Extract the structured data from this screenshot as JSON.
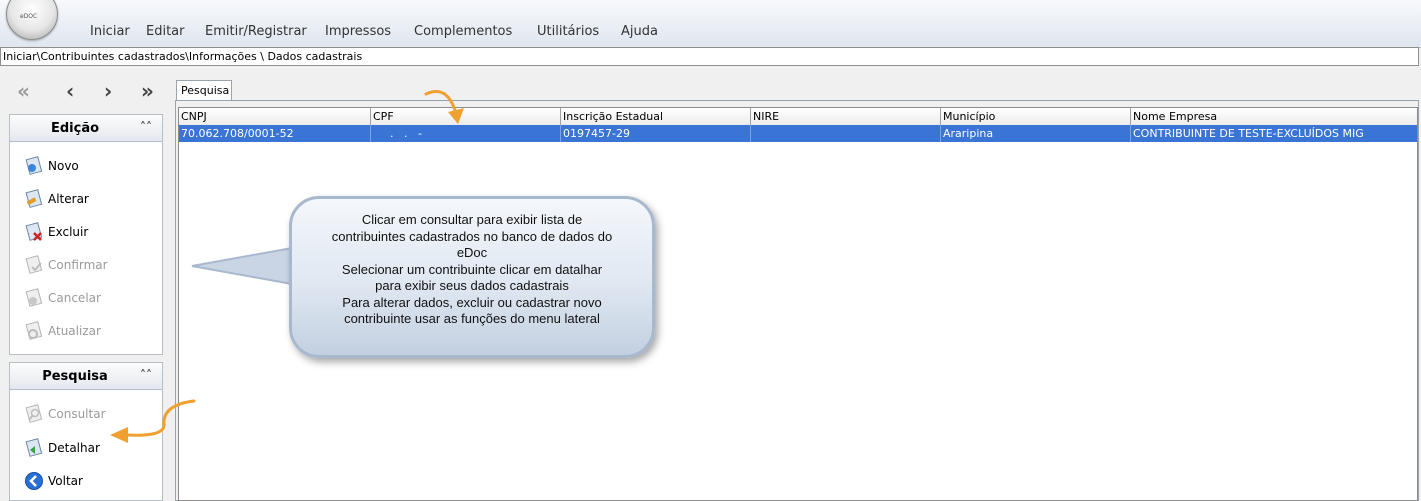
{
  "app": {
    "logo_text": "eDOC"
  },
  "menu": {
    "items": [
      "Iniciar",
      "Editar",
      "Emitir/Registrar",
      "Impressos",
      "Complementos",
      "Utilitários",
      "Ajuda"
    ]
  },
  "breadcrumb": "Iniciar\\Contribuintes cadastrados\\Informações \\ Dados cadastrais",
  "nav": {
    "first": "«",
    "prev": "‹",
    "next": "›",
    "last": "»"
  },
  "sidebar": {
    "edicao": {
      "title": "Edição",
      "collapse_icon": "double-chevron-up-icon",
      "actions": [
        {
          "label": "Novo",
          "enabled": true
        },
        {
          "label": "Alterar",
          "enabled": true
        },
        {
          "label": "Excluir",
          "enabled": true
        },
        {
          "label": "Confirmar",
          "enabled": false
        },
        {
          "label": "Cancelar",
          "enabled": false
        },
        {
          "label": "Atualizar",
          "enabled": false
        }
      ]
    },
    "pesquisa": {
      "title": "Pesquisa",
      "collapse_icon": "double-chevron-up-icon",
      "actions": [
        {
          "label": "Consultar",
          "enabled": false
        },
        {
          "label": "Detalhar",
          "enabled": true
        },
        {
          "label": "Voltar",
          "enabled": true
        }
      ]
    }
  },
  "main": {
    "tab_label": "Pesquisa",
    "table": {
      "columns": [
        "CNPJ",
        "CPF",
        "Inscrição Estadual",
        "NIRE",
        "Município",
        "Nome Empresa"
      ],
      "rows": [
        [
          "70.062.708/0001-52",
          "  .   .   -",
          "0197457-29",
          "",
          "Araripina",
          "CONTRIBUINTE DE TESTE-EXCLUÍDOS MIG"
        ]
      ]
    }
  },
  "callout": {
    "lines": [
      "Clicar em consultar para exibir lista de",
      "contribuintes cadastrados no banco de dados do",
      "eDoc",
      "Selecionar um contribuinte clicar em datalhar",
      "para exibir seus dados cadastrais",
      "Para alterar dados,  excluir ou cadastrar novo",
      "contribuinte usar as funções do menu lateral"
    ]
  },
  "colors": {
    "selection": "#3a74d4",
    "arrow": "#f0a030"
  }
}
